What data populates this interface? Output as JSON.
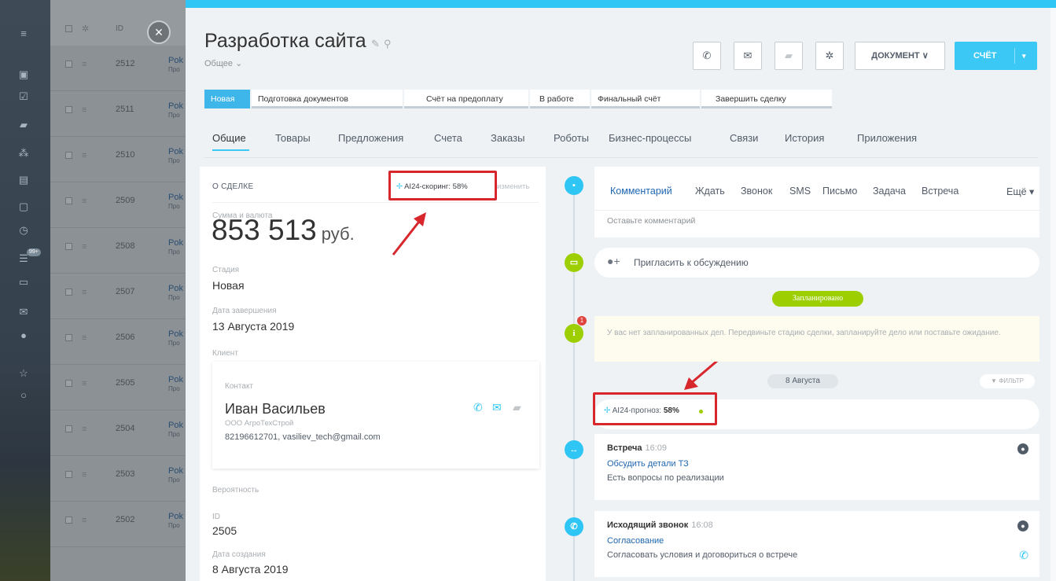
{
  "list": {
    "header": {
      "id_label": "ID"
    },
    "rows": [
      {
        "id": "2512",
        "name": "Pok",
        "sub": "Про"
      },
      {
        "id": "2511",
        "name": "Pok",
        "sub": "Про"
      },
      {
        "id": "2510",
        "name": "Pok",
        "sub": "Про"
      },
      {
        "id": "2509",
        "name": "Pok",
        "sub": "Про"
      },
      {
        "id": "2508",
        "name": "Pok",
        "sub": "Про"
      },
      {
        "id": "2507",
        "name": "Pok",
        "sub": "Про"
      },
      {
        "id": "2506",
        "name": "Pok",
        "sub": "Про"
      },
      {
        "id": "2505",
        "name": "Pok",
        "sub": "Про"
      },
      {
        "id": "2504",
        "name": "Pok",
        "sub": "Про"
      },
      {
        "id": "2503",
        "name": "Pok",
        "sub": "Про"
      },
      {
        "id": "2502",
        "name": "Pok",
        "sub": "Про"
      }
    ],
    "rail_badge": "99+"
  },
  "deal": {
    "title": "Разработка сайта",
    "category": "Общее ⌄"
  },
  "toolbar": {
    "document_label": "ДОКУМЕНТ ∨",
    "invoice_label": "СЧЁТ",
    "invoice_arrow": "▾",
    "call_icon": "phone-icon",
    "mail_icon": "mail-icon",
    "chat_icon": "chat-icon",
    "settings_icon": "gear-icon"
  },
  "stages": [
    {
      "label": "Новая"
    },
    {
      "label": "Подготовка документов"
    },
    {
      "label": "Счёт на предоплату"
    },
    {
      "label": "В работе"
    },
    {
      "label": "Финальный счёт"
    },
    {
      "label": "Завершить сделку"
    }
  ],
  "tabs": [
    "Общие",
    "Товары",
    "Предложения",
    "Счета",
    "Заказы",
    "Роботы",
    "Бизнес-процессы",
    "Связи",
    "История",
    "Приложения"
  ],
  "about": {
    "title": "О СДЕЛКЕ",
    "score": "AI24-скоринг: 58%",
    "change": "изменить",
    "amount_label": "Сумма и валюта",
    "amount": "853 513",
    "currency": "руб.",
    "stage_label": "Стадия",
    "stage_value": "Новая",
    "close_label": "Дата завершения",
    "close_value": "13 Августа 2019",
    "client_label": "Клиент",
    "contact_label": "Контакт",
    "contact_name": "Иван Васильев",
    "contact_company": "ООО АгроТехСтрой",
    "contact_info": "82196612701, vasiliev_tech@gmail.com",
    "probability_label": "Вероятность",
    "id_label": "ID",
    "id_value": "2505",
    "created_label": "Дата создания",
    "created_value": "8 Августа 2019"
  },
  "timeline": {
    "tabs": [
      "Комментарий",
      "Ждать",
      "Звонок",
      "SMS",
      "Письмо",
      "Задача",
      "Встреча",
      "Ещё ▾"
    ],
    "comment_placeholder": "Оставьте комментарий",
    "invite": "Пригласить к обсуждению",
    "planned": "Запланировано",
    "notice": "У вас нет запланированных дел. Передвиньте стадию сделки, запланируйте дело или поставьте ожидание.",
    "notice_badge": "1",
    "date": "8 Августа",
    "filter": "ФИЛЬТР",
    "forecast_label": "AI24-прогноз:",
    "forecast_value": "58%",
    "activities": [
      {
        "title": "Встреча",
        "time": "16:09",
        "link": "Обсудить детали ТЗ",
        "desc": "Есть вопросы по реализации"
      },
      {
        "title": "Исходящий звонок",
        "time": "16:08",
        "link": "Согласование",
        "desc": "Согласовать условия и договориться о встрече"
      }
    ]
  },
  "colors": {
    "accent": "#3bc8f5",
    "highlight_box": "#d8262d",
    "planned": "#9dcf00"
  }
}
